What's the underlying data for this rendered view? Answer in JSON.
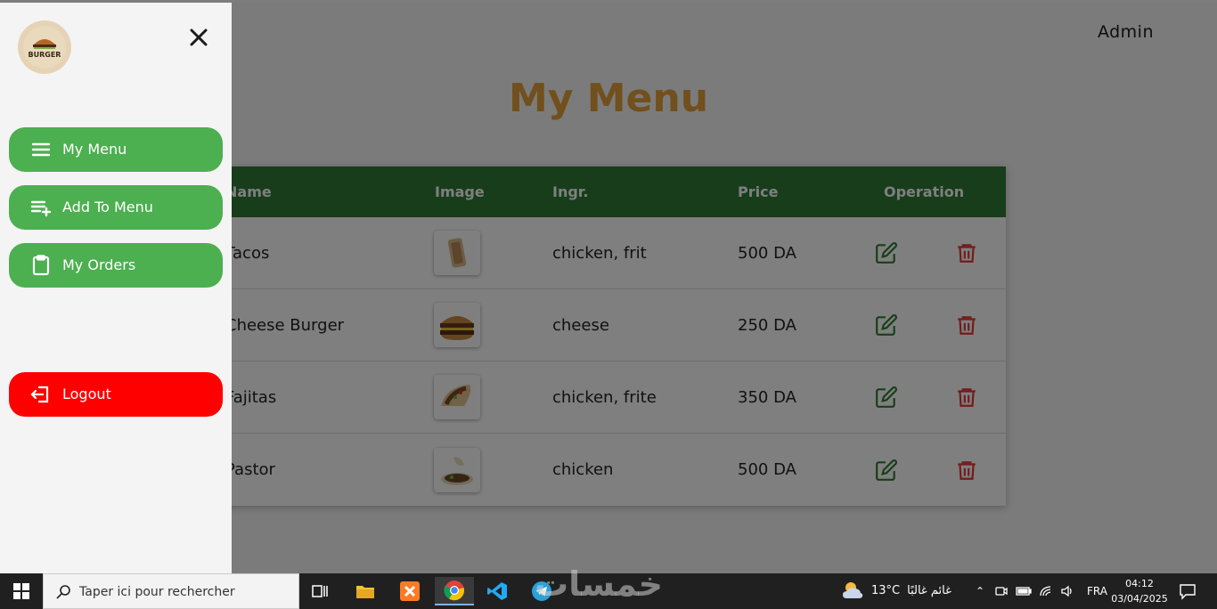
{
  "header": {
    "user": "Admin"
  },
  "page": {
    "title": "My Menu"
  },
  "table": {
    "columns": [
      "Name",
      "Image",
      "Ingr.",
      "Price",
      "Operation"
    ],
    "rows": [
      {
        "name": "Tacos",
        "ingredients": "chicken, frit",
        "price": "500 DA"
      },
      {
        "name": "Cheese Burger",
        "ingredients": "cheese",
        "price": "250 DA"
      },
      {
        "name": "Fajitas",
        "ingredients": "chicken, frite",
        "price": "350 DA"
      },
      {
        "name": "Pastor",
        "ingredients": "chicken",
        "price": "500 DA"
      }
    ]
  },
  "sidebar": {
    "logo_text": "BURGER",
    "items": [
      {
        "label": "My Menu",
        "icon": "menu-lines-icon"
      },
      {
        "label": "Add To Menu",
        "icon": "playlist-add-icon"
      },
      {
        "label": "My Orders",
        "icon": "clipboard-icon"
      }
    ],
    "logout_label": "Logout"
  },
  "taskbar": {
    "search_placeholder": "Taper ici pour rechercher",
    "weather_temp": "13°C",
    "weather_text": "غائم غالبًا",
    "language": "FRA",
    "time": "04:12",
    "date": "03/04/2025"
  },
  "watermark": "خمسات",
  "colors": {
    "accent_green": "#4caf50",
    "table_header": "#2f7a34",
    "title": "#e3a13a",
    "logout_red": "#ff0000",
    "edit_green": "#2e7d32",
    "delete_red": "#e53935"
  }
}
